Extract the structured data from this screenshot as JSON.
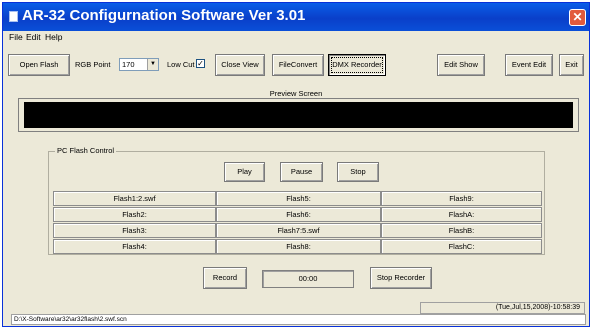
{
  "window": {
    "title": "AR-32 Configurnation Software Ver 3.01",
    "close_glyph": "✕"
  },
  "menu": [
    "File",
    "Edit",
    "Help"
  ],
  "toolbar": {
    "open_flash": "Open Flash",
    "rgb_label": "RGB Point",
    "rgb_value": "170",
    "lowcut_label": "Low Cut",
    "lowcut_checked": "✓",
    "close_view": "Close View",
    "file_convert": "FileConvert",
    "dmx_recorder": "DMX Recorder",
    "edit_show": "Edit Show",
    "event_edit": "Event Edit",
    "exit": "Exit"
  },
  "preview": {
    "label": "Preview Screen"
  },
  "flash_control": {
    "title": "PC Flash Control",
    "play": "Play",
    "pause": "Pause",
    "stop": "Stop",
    "slots": [
      [
        "Flash1:2.swf",
        "Flash5:",
        "Flash9:"
      ],
      [
        "Flash2:",
        "Flash6:",
        "FlashA:"
      ],
      [
        "Flash3:",
        "Flash7:5.swf",
        "FlashB:"
      ],
      [
        "Flash4:",
        "Flash8:",
        "FlashC:"
      ]
    ]
  },
  "recorder": {
    "record": "Record",
    "time": "00:00",
    "stop_recorder": "Stop Recorder"
  },
  "status": {
    "datetime": "(Tue,Jul,15,2008)-10:58:39",
    "path": "D:\\X-Software\\ar32\\ar32flash\\2.swf.scn"
  },
  "icons": {
    "app": "app-icon",
    "close": "close-icon",
    "dropdown": "chevron-down-icon",
    "check": "checkmark-icon"
  }
}
